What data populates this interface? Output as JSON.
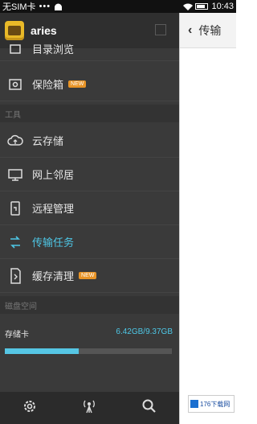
{
  "status_bar": {
    "carrier": "无SIM卡",
    "dots": "•••",
    "time": "10:43"
  },
  "drawer": {
    "app_name": "aries",
    "items": [
      {
        "label": "目录浏览",
        "icon": "folder-icon",
        "badge": ""
      },
      {
        "label": "保险箱",
        "icon": "safe-icon",
        "badge": "NEW"
      },
      {
        "label": "云存储",
        "icon": "cloud-icon",
        "badge": ""
      },
      {
        "label": "网上邻居",
        "icon": "monitor-icon",
        "badge": ""
      },
      {
        "label": "远程管理",
        "icon": "remote-icon",
        "badge": ""
      },
      {
        "label": "传输任务",
        "icon": "transfer-icon",
        "badge": ""
      },
      {
        "label": "缓存清理",
        "icon": "cache-icon",
        "badge": "NEW"
      }
    ],
    "sections": {
      "tools": "工具",
      "disk_space": "磁盘空间"
    },
    "storage": {
      "name": "存储卡",
      "usage": "6.42GB/9.37GB",
      "used_fraction": 0.44
    }
  },
  "panel": {
    "back": "‹",
    "title": "传输"
  },
  "watermark": "176下载网",
  "colors": {
    "accent": "#4ec7e6",
    "badge": "#e89427",
    "drawer_bg": "#3a3a3a"
  }
}
